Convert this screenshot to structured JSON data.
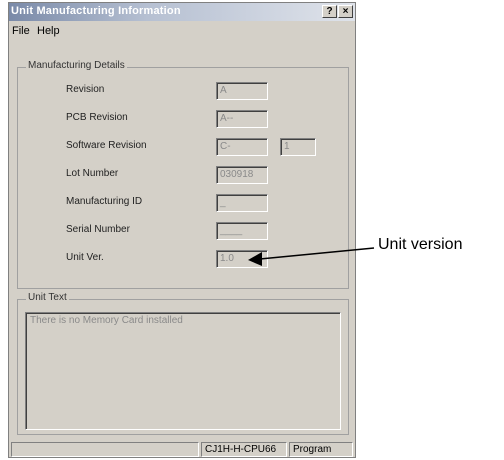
{
  "window": {
    "title": "Unit Manufacturing Information",
    "help_button": "?",
    "close_button": "×"
  },
  "menu": {
    "file": "File",
    "help": "Help"
  },
  "manufacturing_details": {
    "group_label": "Manufacturing Details",
    "rows": [
      {
        "label": "Revision",
        "value": "A"
      },
      {
        "label": "PCB Revision",
        "value": "A--"
      },
      {
        "label": "Software Revision",
        "value": "C-",
        "value2": "1"
      },
      {
        "label": "Lot Number",
        "value": "030918"
      },
      {
        "label": "Manufacturing ID",
        "value": "_"
      },
      {
        "label": "Serial Number",
        "value": "____"
      },
      {
        "label": "Unit Ver.",
        "value": "1.0"
      }
    ]
  },
  "unit_text": {
    "group_label": "Unit Text",
    "message": "There is no Memory Card installed"
  },
  "status_bar": {
    "model": "CJ1H-H-CPU66",
    "mode": "Program"
  },
  "annotation": {
    "text": "Unit version"
  }
}
